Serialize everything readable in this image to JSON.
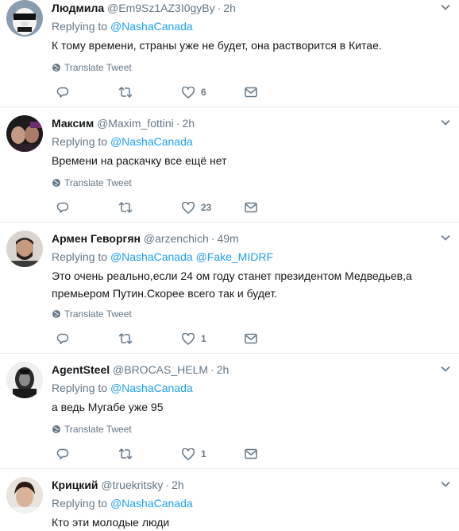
{
  "common": {
    "replying_prefix": "Replying to",
    "translate_label": "Translate Tweet"
  },
  "tweets": [
    {
      "name": "Людмила",
      "handle": "@Em9Sz1AZ3I0gyBy",
      "dot": "·",
      "time": "2h",
      "replying_to": [
        "@NashaCanada"
      ],
      "text": "К тому времени, страны уже не будет, она растворится в Китае.",
      "likes": "6"
    },
    {
      "name": "Максим",
      "handle": "@Maxim_fottini",
      "dot": "·",
      "time": "2h",
      "replying_to": [
        "@NashaCanada"
      ],
      "text": "Времени на раскачку все ещё нет",
      "likes": "23"
    },
    {
      "name": "Армен Геворгян",
      "handle": "@arzenchich",
      "dot": "·",
      "time": "49m",
      "replying_to": [
        "@NashaCanada",
        "@Fake_MIDRF"
      ],
      "text": "Это очень реально,если 24 ом году станет президентом Медведьев,а премьером Путин.Скорее всего так и будет.",
      "likes": "1"
    },
    {
      "name": "AgentSteel",
      "handle": "@BROCAS_HELM",
      "dot": "·",
      "time": "2h",
      "replying_to": [
        "@NashaCanada"
      ],
      "text": "а ведь Мугабе уже 95",
      "likes": "1"
    },
    {
      "name": "Крицкий",
      "handle": "@truekritsky",
      "dot": "·",
      "time": "2h",
      "replying_to": [
        "@NashaCanada"
      ],
      "text": "Кто эти молодые люди"
    }
  ]
}
